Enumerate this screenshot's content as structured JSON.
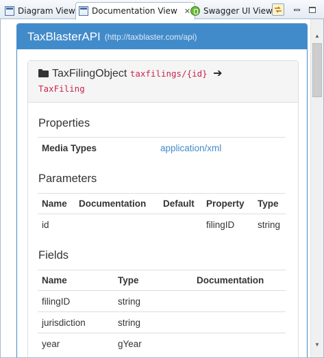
{
  "tabs": [
    {
      "label": "Diagram View",
      "icon": "diagram-view-icon",
      "active": false
    },
    {
      "label": "Documentation View",
      "icon": "documentation-view-icon",
      "active": true
    },
    {
      "label": "Swagger UI View",
      "icon": "swagger-icon",
      "active": false
    }
  ],
  "toolbar": {
    "close_glyph": "✕",
    "link_icon": "link-with-editor-icon",
    "minimize_icon": "minimize-icon",
    "maximize_icon": "maximize-icon"
  },
  "api": {
    "title": "TaxBlasterAPI",
    "url": "(http://taxblaster.com/api)"
  },
  "resource": {
    "name": "TaxFilingObject",
    "path": "taxfilings/{id}",
    "arrow": "➔",
    "type": "TaxFiling"
  },
  "properties": {
    "title": "Properties",
    "rows": [
      {
        "key": "Media Types",
        "value": "application/xml"
      }
    ]
  },
  "parameters": {
    "title": "Parameters",
    "headers": [
      "Name",
      "Documentation",
      "Default",
      "Property",
      "Type"
    ],
    "rows": [
      [
        "id",
        "",
        "",
        "filingID",
        "string"
      ]
    ]
  },
  "fields": {
    "title": "Fields",
    "headers": [
      "Name",
      "Type",
      "Documentation"
    ],
    "rows": [
      [
        "filingID",
        "string",
        ""
      ],
      [
        "jurisdiction",
        "string",
        ""
      ],
      [
        "year",
        "gYear",
        ""
      ]
    ]
  },
  "colors": {
    "primary": "#428bca",
    "code": "#c7254e",
    "link": "#428bca"
  }
}
